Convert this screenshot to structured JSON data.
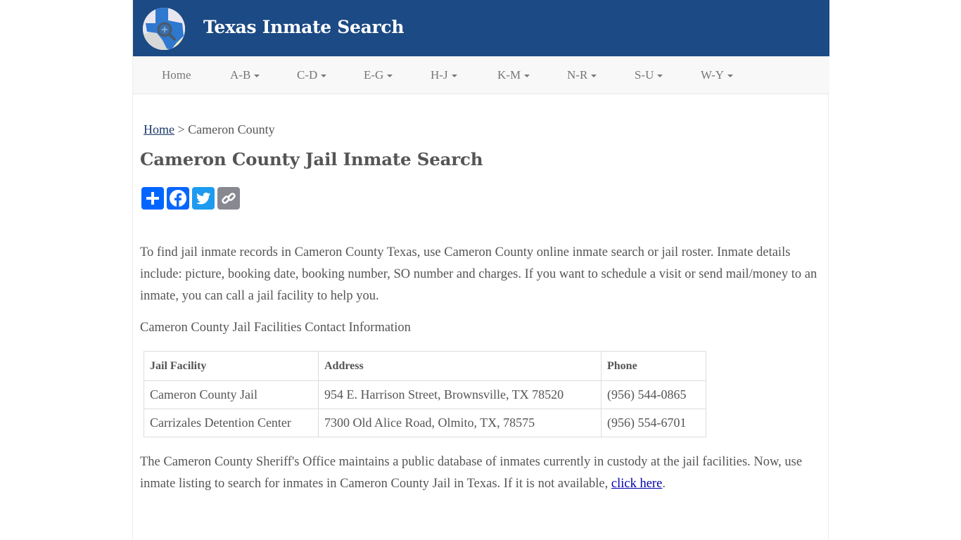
{
  "header": {
    "site_title": "Texas Inmate Search",
    "logo_icon": "texas-map-magnifier-icon",
    "brand_color": "#1c4a84"
  },
  "nav": {
    "items": [
      {
        "label": "Home",
        "dropdown": false
      },
      {
        "label": "A-B",
        "dropdown": true
      },
      {
        "label": "C-D",
        "dropdown": true
      },
      {
        "label": "E-G",
        "dropdown": true
      },
      {
        "label": "H-J",
        "dropdown": true
      },
      {
        "label": "K-M",
        "dropdown": true
      },
      {
        "label": "N-R",
        "dropdown": true
      },
      {
        "label": "S-U",
        "dropdown": true
      },
      {
        "label": "W-Y",
        "dropdown": true
      }
    ]
  },
  "breadcrumb": {
    "home": "Home",
    "separator": ">",
    "current": "Cameron County"
  },
  "page_title": "Cameron County Jail Inmate Search",
  "share": {
    "buttons": [
      {
        "name": "share",
        "icon": "plus-icon",
        "color": "#0166ff"
      },
      {
        "name": "facebook",
        "icon": "facebook-icon",
        "color": "#0866ff"
      },
      {
        "name": "twitter",
        "icon": "twitter-icon",
        "color": "#1d9bf0"
      },
      {
        "name": "copy-link",
        "icon": "link-icon",
        "color": "#888990"
      }
    ]
  },
  "intro": "To find jail inmate records in Cameron County Texas, use Cameron County online inmate search or jail roster. Inmate details include: picture, booking date, booking number, SO number and charges. If you want to schedule a visit or send mail/money to an inmate, you can call a jail facility to help you.",
  "table_caption": "Cameron County Jail Facilities Contact Information",
  "table": {
    "headers": [
      "Jail Facility",
      "Address",
      "Phone"
    ],
    "rows": [
      [
        "Cameron County Jail",
        "954 E. Harrison Street, Brownsville, TX 78520",
        "(956) 544-0865"
      ],
      [
        "Carrizales Detention Center",
        "7300 Old Alice Road, Olmito, TX, 78575",
        "(956) 554-6701"
      ]
    ]
  },
  "outro": {
    "text": "The Cameron County Sheriff's Office maintains a public database of inmates currently in custody at the jail facilities. Now, use inmate listing to search for inmates in Cameron County Jail in Texas. If it is not available, ",
    "link": "click here",
    "end": "."
  }
}
